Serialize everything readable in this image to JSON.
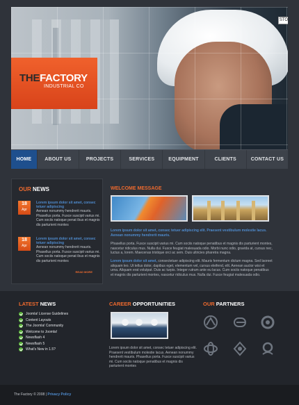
{
  "hero": {
    "logo_the": "THE",
    "logo_factory": "FACTORY",
    "logo_sub": "INDUSTRIAL CO",
    "stop_label": "STOP"
  },
  "nav": {
    "items": [
      "HOME",
      "ABOUT US",
      "PROJECTS",
      "SERVICES",
      "EQUIPMENT",
      "CLIENTS",
      "CONTACT US"
    ]
  },
  "news": {
    "title_accent": "OUR",
    "title_rest": " NEWS",
    "items": [
      {
        "day": "18",
        "month": "Apr",
        "headline": "Lorem ipsum dolor sit amet, consec tetuer adipiscing",
        "body": "Aenean nonummy hendrerit mauris. Phasellus porta. Fusce suscipit varius mi. Cum sociis natoque penat ibus et magnis dis parturient montes"
      },
      {
        "day": "18",
        "month": "Apr",
        "headline": "Lorem ipsum dolor sit amet, consec tetuer adipiscing",
        "body": "Aenean nonummy hendrerit mauris. Phasellus porta. Fusce suscipit varius mi. Cum sociis natoque penat ibus et magnis dis parturient montes"
      }
    ],
    "read_more": "READ MORE"
  },
  "welcome": {
    "title": "WELCOME MESSAGE",
    "lead1": "Lorem ipsum dolor sit amet, consec tetuer adipiscing elit. Praesent vestibulum molestie lacus. Aenean nonummy hendrerit mauris.",
    "text1": "Phasellus porta. Fusce suscipit varius mi. Cum sociis natoque penatibus et magnis dis parturient montes, nascetur ridiculus mus. Nulla dui. Fusce feugiat malesuada odio. Morbi nunc odio, gravida at, cursus nec, luctus a, lorem. Maecenas tristique orci ac sem. Duis ultricies pharetra magna.",
    "lead2": "Lorem ipsum dolor sit amet,",
    "text2": "consectetuer adipiscing elit. Mauris fermentum dictum magna. Sed laoreet aliquam leo. Ut tellus dolor, dapibus eget, elementum vel, cursus eleifend, elit. Aenean auctor wisi et urna. Aliquam erat volutpat. Duis ac turpis. Integer rutrum ante eu lacus. Cum sociis natoque penatibus et magnis dis parturient montes, nascetur ridiculus mus. Nulla dui. Fusce feugiat malesuada odio."
  },
  "latest": {
    "title_accent": "LATEST",
    "title_rest": " NEWS",
    "items": [
      "Joomla! License Guidelines",
      "Content Layouts",
      "The Joomla! Community",
      "Welcome to Joomla!",
      "Newsflash 4",
      "Newsflash 5",
      "What's New in 1.5?"
    ]
  },
  "career": {
    "title_accent": "CAREER",
    "title_rest": " OPPORTUNITIES",
    "text": "Lorem ipsum dolor sit amet, consec tetuer adipiscing elit. Praesent vestibulum molestie lacus. Aenean nonummy hendrerit mauris. Phasellus porta. Fusce suscipit varius mi. Cum sociis natoque penatibus et magnis dis parturient montes"
  },
  "partners": {
    "title_accent": "OUR",
    "title_rest": " PARTNERS",
    "icons": [
      "partner-logo-1-icon",
      "partner-logo-2-icon",
      "partner-logo-3-icon",
      "partner-logo-4-icon",
      "partner-logo-5-icon",
      "partner-logo-6-icon"
    ]
  },
  "footer": {
    "copyright": "The Factory © 2008 | ",
    "privacy": "Privacy Policy"
  },
  "colors": {
    "accent": "#ee6a2e",
    "link": "#4f8ccf",
    "nav_active": "#1e4f8d",
    "check": "#5bb33a"
  }
}
